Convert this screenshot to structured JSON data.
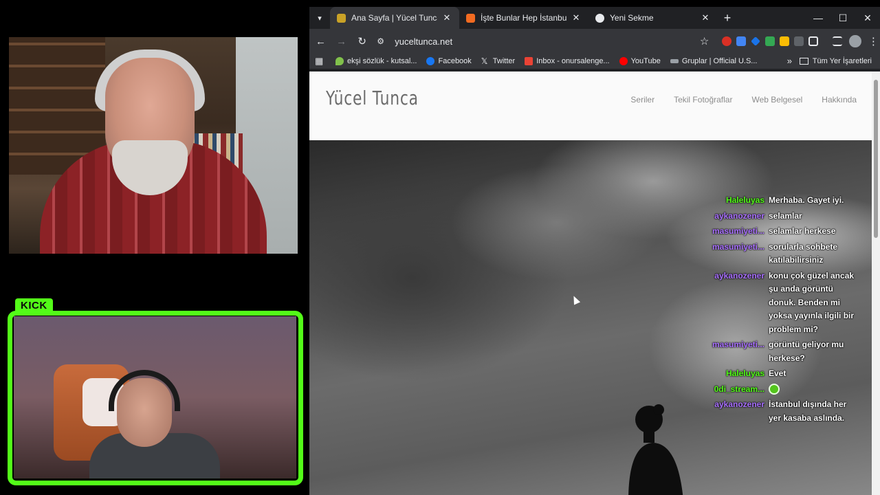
{
  "browser": {
    "tabs": [
      {
        "label": "Ana Sayfa | Yücel Tunca Photog",
        "favicon_color": "#c9a227",
        "active": true
      },
      {
        "label": "İşte Bunlar Hep İstanbul",
        "favicon_color": "#f26b21",
        "active": false
      },
      {
        "label": "Yeni Sekme",
        "favicon_color": "#e8eaed",
        "active": false
      }
    ],
    "address": "yuceltunca.net",
    "bookmarks": [
      {
        "label": "ekşi sözlük - kutsal...",
        "icon_color": "#81c14b"
      },
      {
        "label": "Facebook",
        "icon_color": "#1877f2"
      },
      {
        "label": "Twitter",
        "icon_color": "#e8eaed"
      },
      {
        "label": "Inbox - onursalenge...",
        "icon_color": "#ea4335"
      },
      {
        "label": "YouTube",
        "icon_color": "#ff0000"
      },
      {
        "label": "Gruplar | Official U.S...",
        "icon_color": "#9aa0a6"
      }
    ],
    "all_bookmarks_label": "Tüm Yer İşaretleri",
    "extensions": [
      "#d93025",
      "#4285f4",
      "#1a73e8",
      "#34a853",
      "#fbbc04",
      "#9aa0a6",
      "#e8eaed"
    ]
  },
  "site": {
    "logo": "Yücel Tunca",
    "nav": [
      "Seriler",
      "Tekil Fotoğraflar",
      "Web Belgesel",
      "Hakkında"
    ]
  },
  "overlay": {
    "kick_label": "KICK",
    "kick_color": "#53fc18"
  },
  "chat": [
    {
      "user": "Haleluyas",
      "color": "#53fc18",
      "text": "Merhaba. Gayet iyi."
    },
    {
      "user": "aykanozener",
      "color": "#a970ff",
      "text": "selamlar"
    },
    {
      "user": "masumiyeti...",
      "color": "#a970ff",
      "text": "selamlar herkese"
    },
    {
      "user": "masumiyeti...",
      "color": "#a970ff",
      "text": "sorularla sohbete katılabilirsiniz"
    },
    {
      "user": "aykanozener",
      "color": "#a970ff",
      "text": "konu çok güzel ancak şu anda görüntü donuk. Benden mi yoksa yayınla ilgili bir problem mi?"
    },
    {
      "user": "masumiyeti...",
      "color": "#a970ff",
      "text": "görüntü geliyor mu herkese?"
    },
    {
      "user": "Haleluyas",
      "color": "#53fc18",
      "text": "Evet"
    },
    {
      "user": "0di_stream...",
      "color": "#53fc18",
      "text": "",
      "emote": "green-face"
    },
    {
      "user": "aykanozener",
      "color": "#a970ff",
      "text": "İstanbul dışında her yer kasaba aslında."
    }
  ]
}
